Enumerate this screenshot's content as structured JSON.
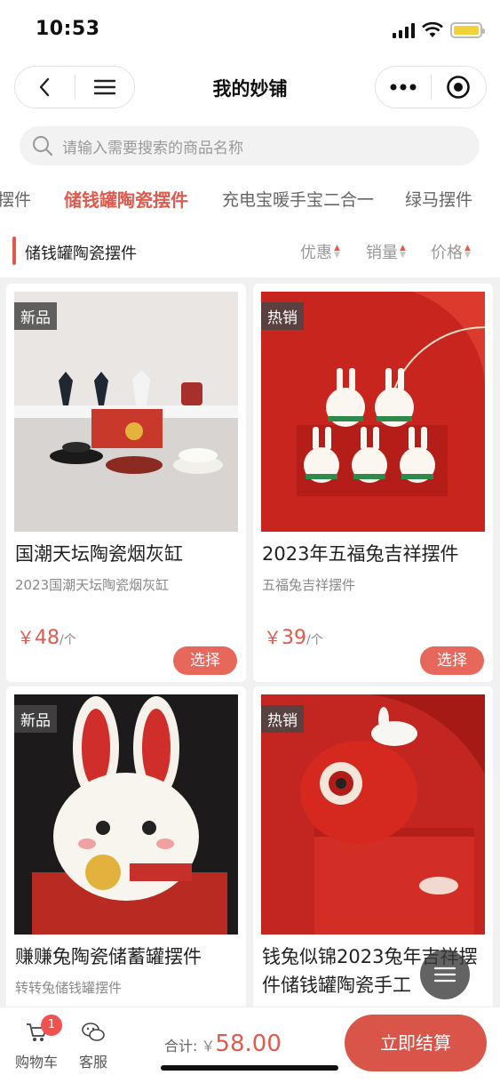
{
  "status": {
    "time": "10:53"
  },
  "navbar": {
    "title": "我的妙铺"
  },
  "search": {
    "placeholder": "请输入需要搜索的商品名称"
  },
  "tabs": [
    {
      "label": "摆件",
      "active": false
    },
    {
      "label": "储钱罐陶瓷摆件",
      "active": true
    },
    {
      "label": "充电宝暖手宝二合一",
      "active": false
    },
    {
      "label": "绿马摆件",
      "active": false
    }
  ],
  "section": {
    "title": "储钱罐陶瓷摆件",
    "sort": [
      "优惠",
      "销量",
      "价格"
    ]
  },
  "products": [
    {
      "badge": "新品",
      "name": "国潮天坛陶瓷烟灰缸",
      "desc": "2023国潮天坛陶瓷烟灰缸",
      "currency": "￥",
      "price": "48",
      "unit": "/个",
      "button": "选择"
    },
    {
      "badge": "热销",
      "name": "2023年五福兔吉祥摆件",
      "desc": "五福兔吉祥摆件",
      "currency": "￥",
      "price": "39",
      "unit": "/个",
      "button": "选择"
    },
    {
      "badge": "新品",
      "name": "赚赚兔陶瓷储蓄罐摆件",
      "desc": "转转兔储钱罐摆件"
    },
    {
      "badge": "热销",
      "name": "钱兔似锦2023兔年吉祥摆件储钱罐陶瓷手工"
    }
  ],
  "bottom": {
    "cart_label": "购物车",
    "cart_count": "1",
    "service_label": "客服",
    "total_label": "合计:",
    "total_currency": "￥",
    "total_amount": "58.00",
    "checkout_label": "立即结算"
  },
  "colors": {
    "accent": "#e05a4e",
    "button": "#e8675b",
    "checkout": "#d9554a",
    "badge_bg": "#464646"
  },
  "icons": [
    "back-icon",
    "menu-icon",
    "more-icon",
    "target-icon",
    "search-icon",
    "cart-icon",
    "chat-icon",
    "float-menu-icon"
  ]
}
